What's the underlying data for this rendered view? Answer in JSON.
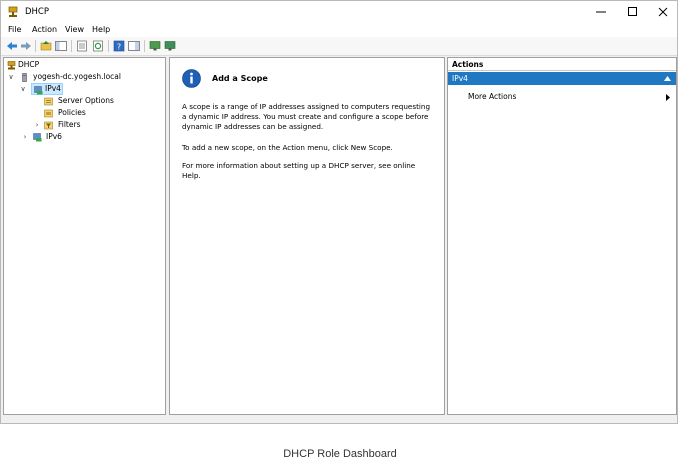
{
  "window": {
    "title": "DHCP",
    "icon": "dhcp-server-icon"
  },
  "menu": [
    "File",
    "Action",
    "View",
    "Help"
  ],
  "tree": {
    "root": "DHCP",
    "server": "yogesh-dc.yogesh.local",
    "ipv4": "IPv4",
    "server_options": "Server Options",
    "policies": "Policies",
    "filters": "Filters",
    "ipv6": "IPv6"
  },
  "main": {
    "title": "Add a Scope",
    "para1": "A scope is a range of IP addresses assigned to computers requesting a dynamic IP address. You must create and configure a scope before dynamic IP addresses can be assigned.",
    "para2": "To add a new scope, on the Action menu, click New Scope.",
    "para3": "For more information about setting up a DHCP server, see online Help."
  },
  "actions": {
    "header": "Actions",
    "section": "IPv4",
    "more": "More Actions"
  },
  "caption": "DHCP Role Dashboard",
  "colors": {
    "accent": "#1f78c1",
    "selection": "#cce8ff"
  }
}
